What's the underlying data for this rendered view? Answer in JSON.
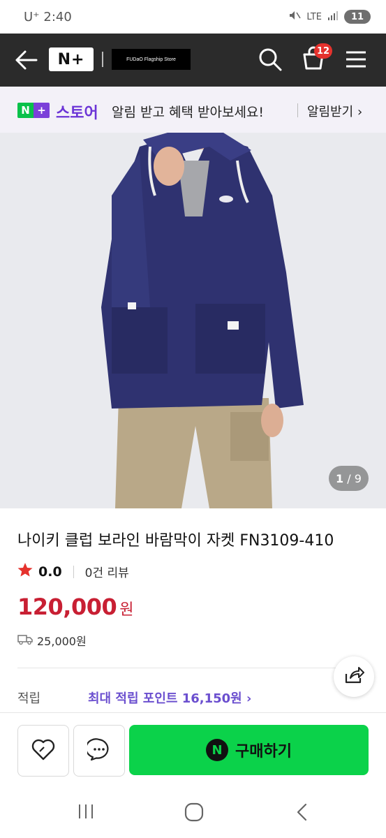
{
  "status": {
    "carrier": "U⁺ 2:40",
    "network": "LTE",
    "battery": "11"
  },
  "nav": {
    "logo": "N+",
    "store_name": "FUDaO Flagship Store",
    "cart_count": "12"
  },
  "promo": {
    "brand_box_n": "N",
    "brand_box_plus": "+",
    "brand": "스토어",
    "message": "알림 받고 혜택 받아보세요!",
    "action": "알림받기 ›"
  },
  "image": {
    "indicator_current": "1",
    "indicator_total": "/ 9"
  },
  "product": {
    "title": "나이키 클럽 보라인 바람막이 자켓 FN3109-410",
    "rating": "0.0",
    "reviews": "0건 리뷰",
    "price": "120,000",
    "currency": "원",
    "shipping": "25,000원",
    "points_label": "적립",
    "points_text": "최대 적립 포인트 16,150원 ›"
  },
  "actions": {
    "buy_label": "구매하기",
    "buy_icon": "N"
  }
}
